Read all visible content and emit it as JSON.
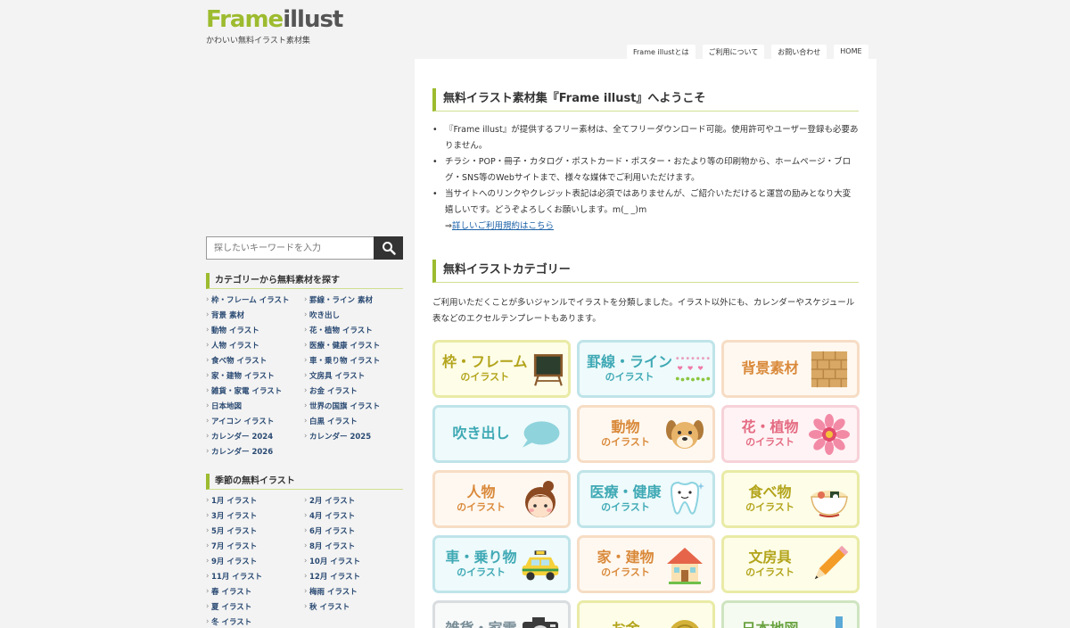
{
  "logo": {
    "text_a": "Frame",
    "text_b": "illust",
    "tagline": "かわいい無料イラスト素材集"
  },
  "nav": [
    "Frame illustとは",
    "ご利用について",
    "お問い合わせ",
    "HOME"
  ],
  "welcome": {
    "title": "無料イラスト素材集『Frame illust』へようこそ",
    "items": [
      "『Frame illust』が提供するフリー素材は、全てフリーダウンロード可能。使用許可やユーザー登録も必要ありません。",
      "チラシ・POP・冊子・カタログ・ポストカード・ポスター・おたより等の印刷物から、ホームページ・ブログ・SNS等のWebサイトまで、様々な媒体でご利用いただけます。",
      "当サイトへのリンクやクレジット表記は必須ではありませんが、ご紹介いただけると運営の励みとなり大変嬉しいです。どうぞよろしくお願いします。m(_ _)m"
    ],
    "link_prefix": "⇒",
    "link_text": "詳しいご利用規約はこちら"
  },
  "categories": {
    "title": "無料イラストカテゴリー",
    "description": "ご利用いただくことが多いジャンルでイラストを分類しました。イラスト以外にも、カレンダーやスケジュール表などのエクセルテンプレートもあります。",
    "tiles": [
      {
        "main": "枠・フレーム",
        "sub": "のイラスト",
        "color": "yellow",
        "icon": "blackboard-icon"
      },
      {
        "main": "罫線・ライン",
        "sub": "のイラスト",
        "color": "teal",
        "icon": "lines-icon"
      },
      {
        "main": "背景素材",
        "sub": "",
        "color": "peach",
        "icon": "brick-wall-icon"
      },
      {
        "main": "吹き出し",
        "sub": "",
        "color": "teal",
        "icon": "speech-bubble-icon"
      },
      {
        "main": "動物",
        "sub": "のイラスト",
        "color": "peach",
        "icon": "dog-icon"
      },
      {
        "main": "花・植物",
        "sub": "のイラスト",
        "color": "pink",
        "icon": "flower-icon"
      },
      {
        "main": "人物",
        "sub": "のイラスト",
        "color": "peach",
        "icon": "girl-face-icon"
      },
      {
        "main": "医療・健康",
        "sub": "のイラスト",
        "color": "teal",
        "icon": "tooth-icon"
      },
      {
        "main": "食べ物",
        "sub": "のイラスト",
        "color": "yellow",
        "icon": "ramen-icon"
      },
      {
        "main": "車・乗り物",
        "sub": "のイラスト",
        "color": "teal",
        "icon": "taxi-icon"
      },
      {
        "main": "家・建物",
        "sub": "のイラスト",
        "color": "peach",
        "icon": "house-icon"
      },
      {
        "main": "文房具",
        "sub": "のイラスト",
        "color": "yellow",
        "icon": "pencil-icon"
      },
      {
        "main": "雑貨・家電",
        "sub": "",
        "color": "gray",
        "icon": "camera-icon"
      },
      {
        "main": "お金",
        "sub": "",
        "color": "yellow",
        "icon": "coin-icon"
      },
      {
        "main": "日本地図",
        "sub": "",
        "color": "green",
        "icon": "japan-map-icon"
      }
    ]
  },
  "sidebar": {
    "search_placeholder": "探したいキーワードを入力",
    "cat_title": "カテゴリーから無料素材を探す",
    "cat_links": [
      "枠・フレーム イラスト",
      "罫線・ライン 素材",
      "背景 素材",
      "吹き出し",
      "動物 イラスト",
      "花・植物 イラスト",
      "人物 イラスト",
      "医療・健康 イラスト",
      "食べ物 イラスト",
      "車・乗り物 イラスト",
      "家・建物 イラスト",
      "文房具 イラスト",
      "雑貨・家電 イラスト",
      "お金 イラスト",
      "日本地図",
      "世界の国旗 イラスト",
      "アイコン イラスト",
      "白黒 イラスト",
      "カレンダー 2024",
      "カレンダー 2025",
      "カレンダー 2026"
    ],
    "season_title": "季節の無料イラスト",
    "season_links": [
      "1月 イラスト",
      "2月 イラスト",
      "3月 イラスト",
      "4月 イラスト",
      "5月 イラスト",
      "6月 イラスト",
      "7月 イラスト",
      "8月 イラスト",
      "9月 イラスト",
      "10月 イラスト",
      "11月 イラスト",
      "12月 イラスト",
      "春 イラスト",
      "梅雨 イラスト",
      "夏 イラスト",
      "秋 イラスト",
      "冬 イラスト"
    ]
  }
}
